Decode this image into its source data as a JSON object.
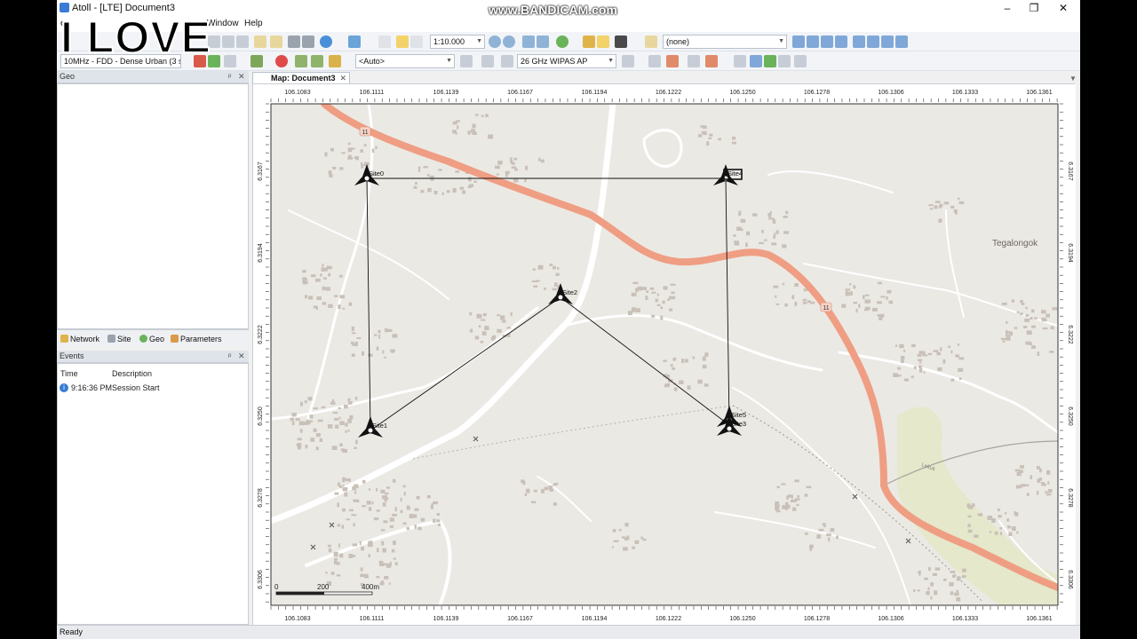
{
  "window": {
    "title": "Atoll - [LTE] Document3",
    "minimize": "–",
    "maximize": "❐",
    "close": "✕"
  },
  "menu": {
    "window": "Window",
    "help": "Help",
    "partial": "e"
  },
  "toolbar1": {
    "scale": "1:10.000",
    "selection": "(none)"
  },
  "toolbar2": {
    "radio_config": "10MHz - FDD - Dense Urban (3 sec",
    "auto": "<Auto>",
    "frequency": "26 GHz WIPAS AP"
  },
  "geo_panel": {
    "title": "Geo",
    "pin": "ᵖ",
    "close": "✕"
  },
  "explorer_tabs": [
    "Network",
    "Site",
    "Geo",
    "Parameters"
  ],
  "events_panel": {
    "title": "Events",
    "columns": {
      "time": "Time",
      "description": "Description"
    },
    "rows": [
      {
        "time": "9:16:36 PM",
        "description": "Session Start"
      }
    ]
  },
  "map": {
    "tab_label": "Map: Document3",
    "tab_close": "✕",
    "x_ticks": [
      "106.1083",
      "106.1111",
      "106.1139",
      "106.1167",
      "106.1194",
      "106.1222",
      "106.1250",
      "106.1278",
      "106.1306",
      "106.1333",
      "106.1361"
    ],
    "y_ticks": [
      "6.3167",
      "6.3194",
      "6.3222",
      "6.3250",
      "6.3278",
      "6.3306"
    ],
    "sites": [
      {
        "name": "Site0"
      },
      {
        "name": "Site4"
      },
      {
        "name": "Site2"
      },
      {
        "name": "Site1"
      },
      {
        "name": "Site5"
      },
      {
        "name": "Site3"
      }
    ],
    "road_label": "11",
    "place_label": "Tegalongok",
    "river_label": "Leltuk",
    "scalebar": {
      "zero": "0",
      "mid": "200",
      "end": "400m"
    },
    "colors": {
      "background": "#ebe9e4",
      "road": "#ef9e83",
      "building": "#c9c0b8",
      "minor_road": "#ffffff",
      "link": "#111111"
    }
  },
  "status": {
    "text": "Ready"
  },
  "overlay": {
    "love": "I LOVE",
    "watermark": "www.BANDICAM.com"
  }
}
